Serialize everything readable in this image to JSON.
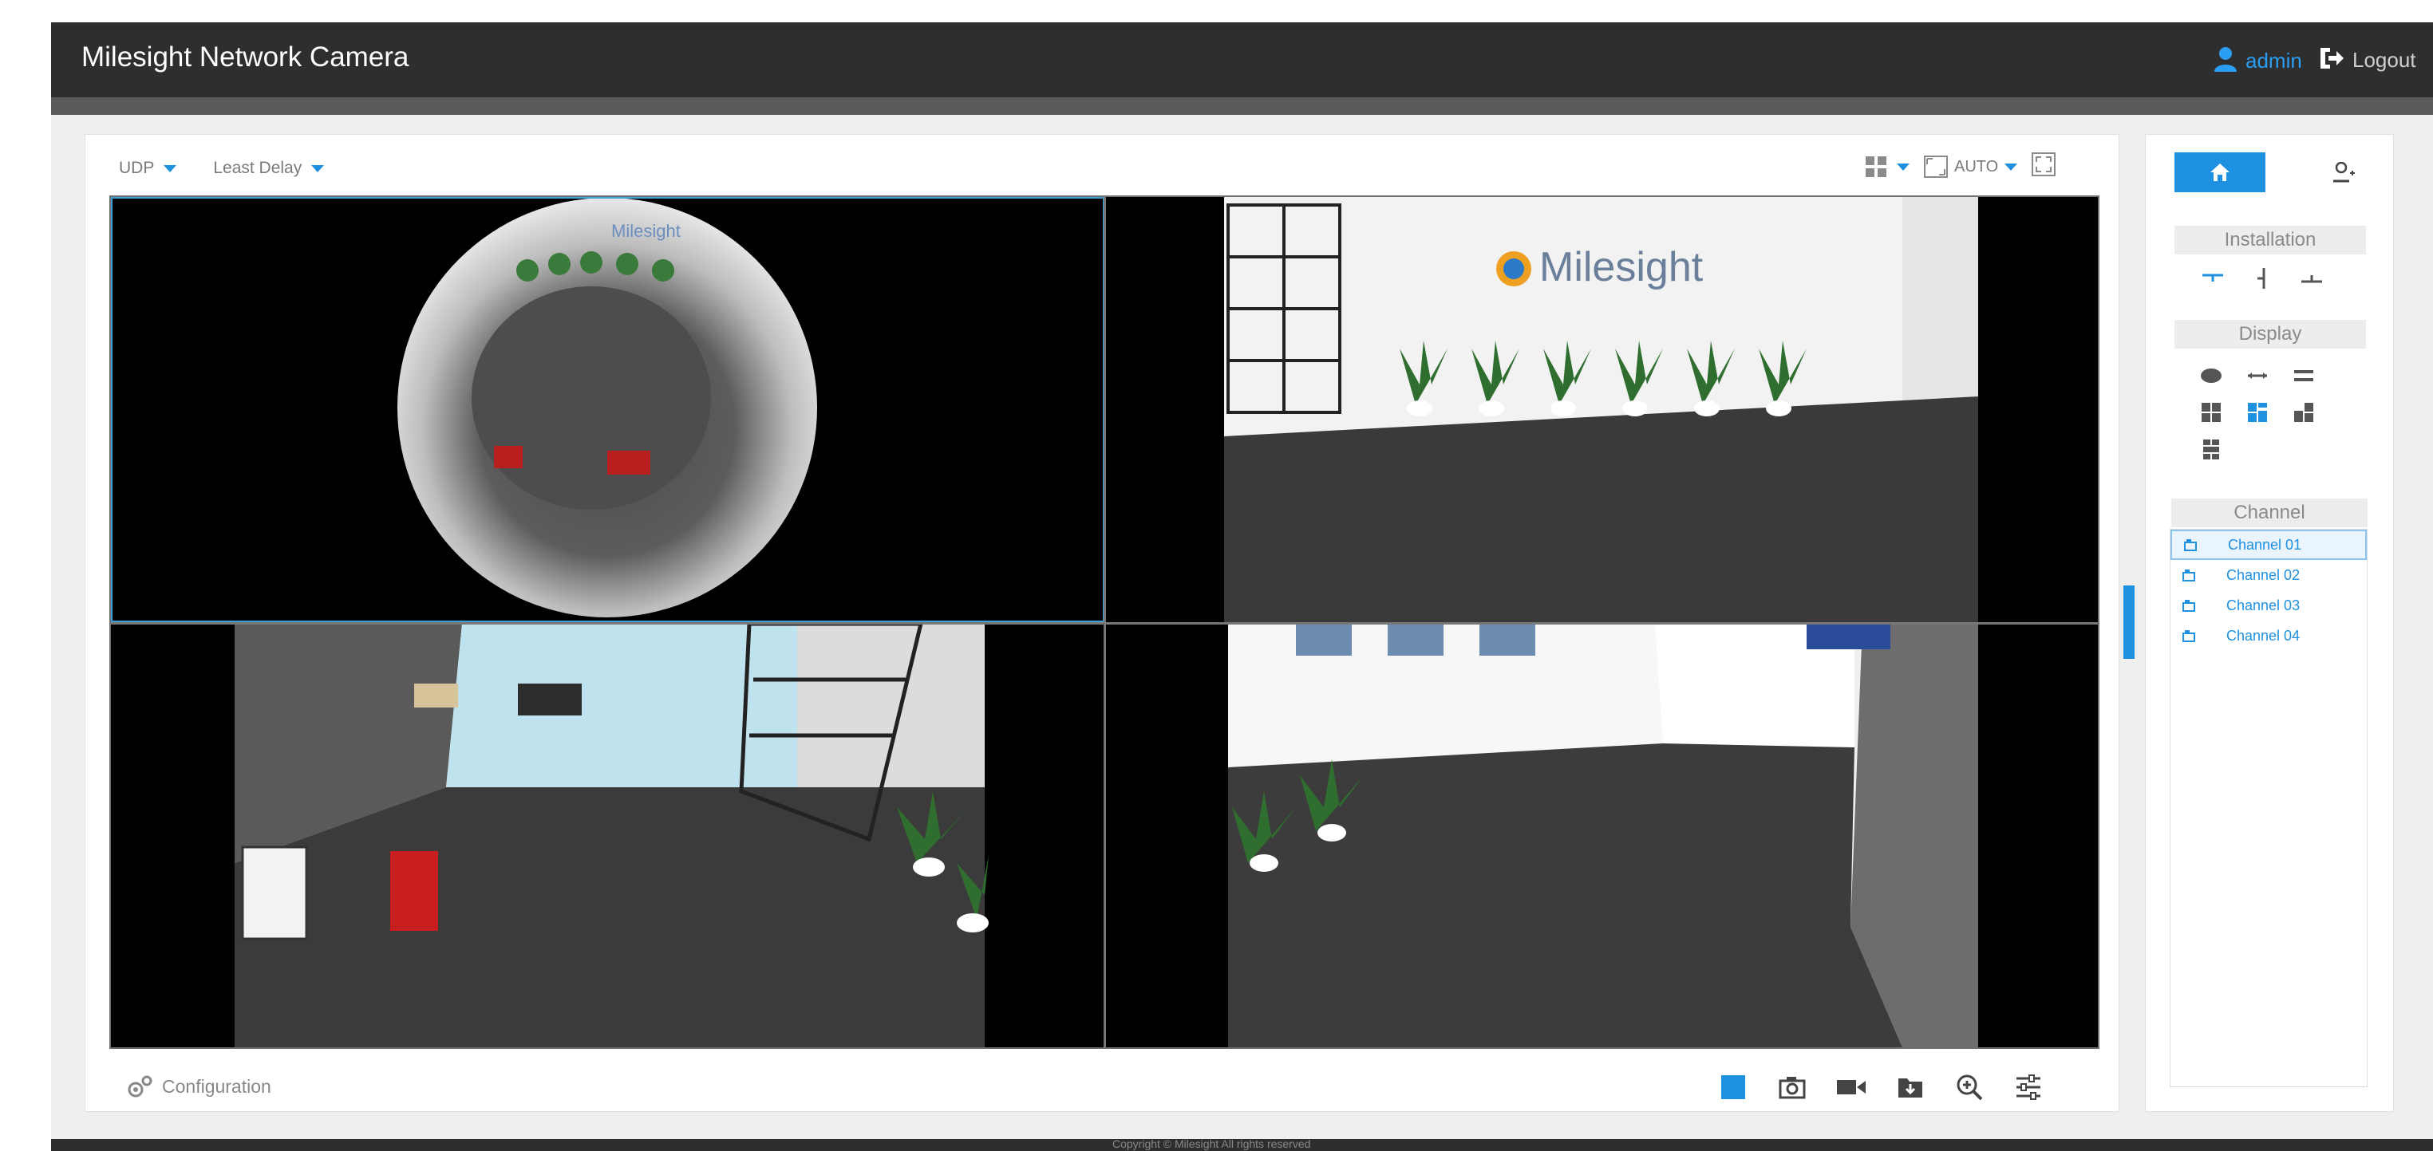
{
  "header": {
    "title": "Milesight Network Camera",
    "user": "admin",
    "logout_label": "Logout"
  },
  "toolbar": {
    "protocol": "UDP",
    "stream_mode": "Least Delay",
    "auto_label": "AUTO"
  },
  "views": {
    "logo_text_1": "Milesight",
    "logo_text_2": "Milesight"
  },
  "bottombar": {
    "configuration_label": "Configuration"
  },
  "side_panel": {
    "installation_label": "Installation",
    "display_label": "Display",
    "channel_label": "Channel",
    "channels": [
      "Channel 01",
      "Channel 02",
      "Channel 03",
      "Channel 04"
    ]
  },
  "footer": {
    "copyright": "Copyright © Milesight All rights reserved"
  },
  "colors": {
    "accent": "#1e90e0",
    "topbar": "#2e2e2e"
  }
}
